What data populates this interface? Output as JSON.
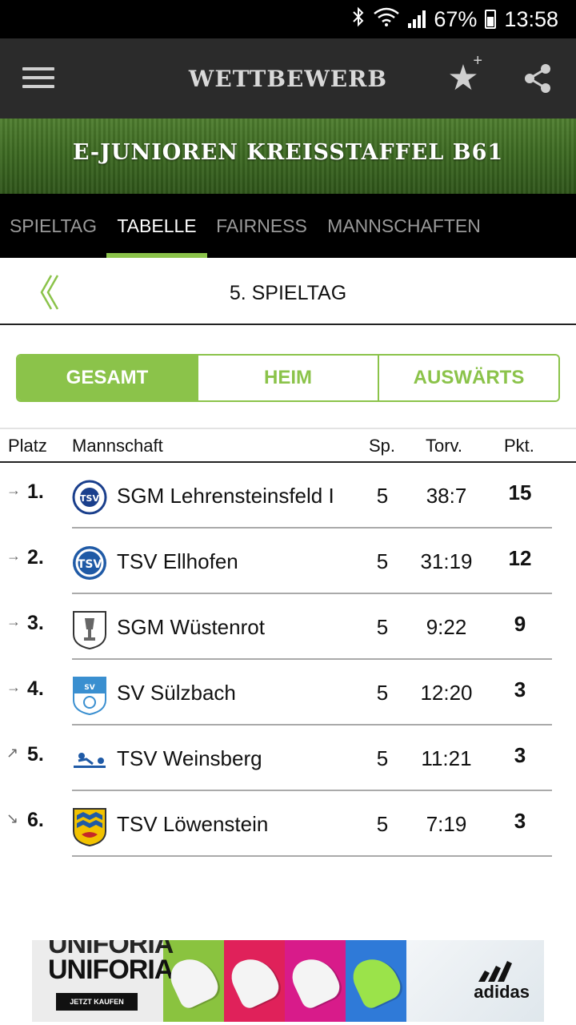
{
  "status_bar": {
    "battery": "67%",
    "time": "13:58",
    "icons": [
      "bluetooth-icon",
      "wifi-icon",
      "signal-icon",
      "battery-icon"
    ]
  },
  "app_bar": {
    "title": "WETTBEWERB",
    "icons": [
      "menu-icon",
      "favorite-star-icon",
      "share-icon"
    ]
  },
  "banner": {
    "competition": "E-JUNIOREN KREISSTAFFEL B61"
  },
  "tabs": [
    {
      "label": "SPIELTAG",
      "active": false
    },
    {
      "label": "TABELLE",
      "active": true
    },
    {
      "label": "FAIRNESS",
      "active": false
    },
    {
      "label": "MANNSCHAFTEN",
      "active": false
    }
  ],
  "round": {
    "label": "5. SPIELTAG"
  },
  "filter": {
    "options": [
      "GESAMT",
      "HEIM",
      "AUSWÄRTS"
    ],
    "selected": "GESAMT"
  },
  "table": {
    "headers": {
      "platz": "Platz",
      "mannschaft": "Mannschaft",
      "sp": "Sp.",
      "torv": "Torv.",
      "pkt": "Pkt."
    },
    "rows": [
      {
        "trend": "→",
        "pos": "1.",
        "team": "SGM Lehrensteinsfeld I",
        "sp": "5",
        "torv": "38:7",
        "pkt": "15"
      },
      {
        "trend": "→",
        "pos": "2.",
        "team": "TSV Ellhofen",
        "sp": "5",
        "torv": "31:19",
        "pkt": "12"
      },
      {
        "trend": "→",
        "pos": "3.",
        "team": "SGM Wüstenrot",
        "sp": "5",
        "torv": "9:22",
        "pkt": "9"
      },
      {
        "trend": "→",
        "pos": "4.",
        "team": "SV Sülzbach",
        "sp": "5",
        "torv": "12:20",
        "pkt": "3"
      },
      {
        "trend": "↗",
        "pos": "5.",
        "team": "TSV Weinsberg",
        "sp": "5",
        "torv": "11:21",
        "pkt": "3"
      },
      {
        "trend": "↘",
        "pos": "6.",
        "team": "TSV Löwenstein",
        "sp": "5",
        "torv": "7:19",
        "pkt": "3"
      }
    ]
  },
  "ad": {
    "headline": "UNIFORIA",
    "cta": "JETZT KAUFEN",
    "brand": "adidas"
  },
  "colors": {
    "accent": "#8bc34a",
    "app_bar": "#2b2b2b",
    "tab_bar": "#000000"
  }
}
